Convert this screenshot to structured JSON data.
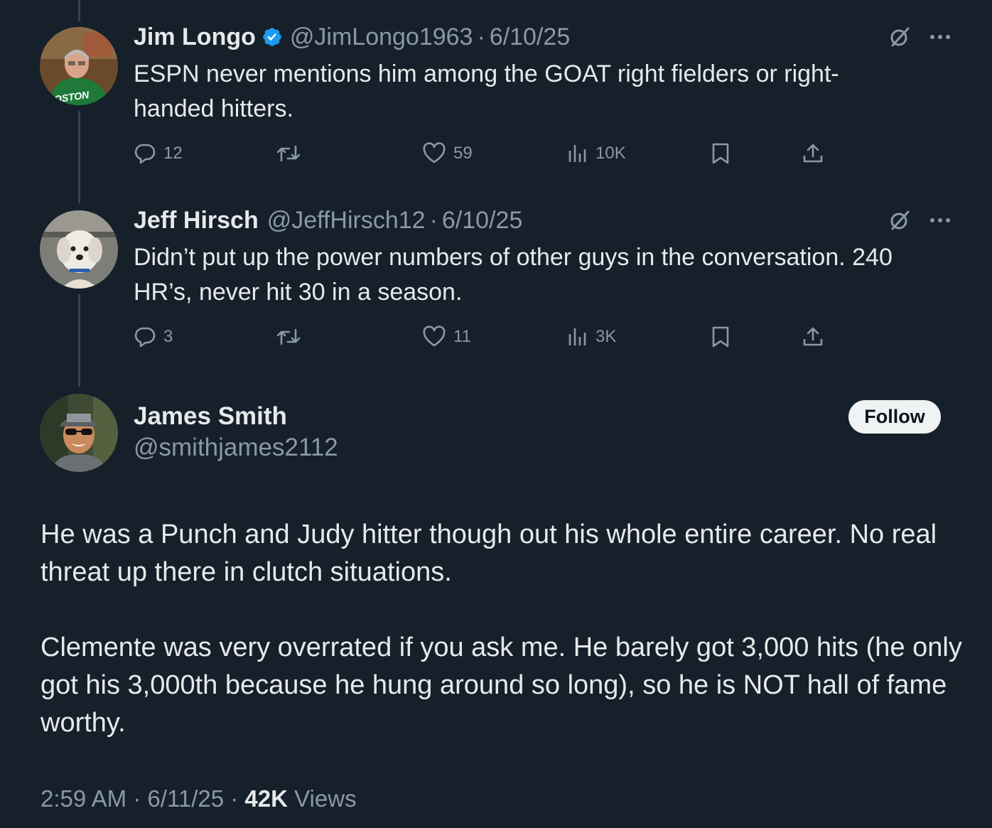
{
  "replies": [
    {
      "name": "Jim Longo",
      "verified": true,
      "handle": "@JimLongo1963",
      "separator": "·",
      "date": "6/10/25",
      "text": "ESPN never mentions him among the GOAT right fielders or right-handed hitters.",
      "stats": {
        "replies": "12",
        "retweets": "",
        "likes": "59",
        "views": "10K"
      },
      "avatar_caption": "OSTON"
    },
    {
      "name": "Jeff Hirsch",
      "verified": false,
      "handle": "@JeffHirsch12",
      "separator": "·",
      "date": "6/10/25",
      "text": "Didn’t put up the power numbers of other guys in the conversation. 240 HR’s, never hit 30 in a season.",
      "stats": {
        "replies": "3",
        "retweets": "",
        "likes": "11",
        "views": "3K"
      }
    }
  ],
  "main_tweet": {
    "name": "James Smith",
    "handle": "@smithjames2112",
    "follow_label": "Follow",
    "paragraphs": [
      "He was a Punch and Judy hitter though out his whole entire career. No real threat up there in clutch situations.",
      "Clemente was very overrated if you ask me. He barely got 3,000 hits (he only got his 3,000th because he hung around so long), so he is NOT hall of fame worthy."
    ],
    "time": "2:59 AM",
    "separator": "·",
    "date": "6/11/25",
    "views_count": "42K",
    "views_label": "Views"
  },
  "colors": {
    "background": "#15202b",
    "text": "#e7e9ea",
    "secondary": "#8b98a5",
    "verified": "#1d9bf0",
    "thread_line": "#38444d",
    "follow_bg": "#eff3f4"
  },
  "icons": [
    "verified-badge-icon",
    "grok-icon",
    "more-icon",
    "reply-icon",
    "retweet-icon",
    "like-icon",
    "views-icon",
    "bookmark-icon",
    "share-icon"
  ]
}
